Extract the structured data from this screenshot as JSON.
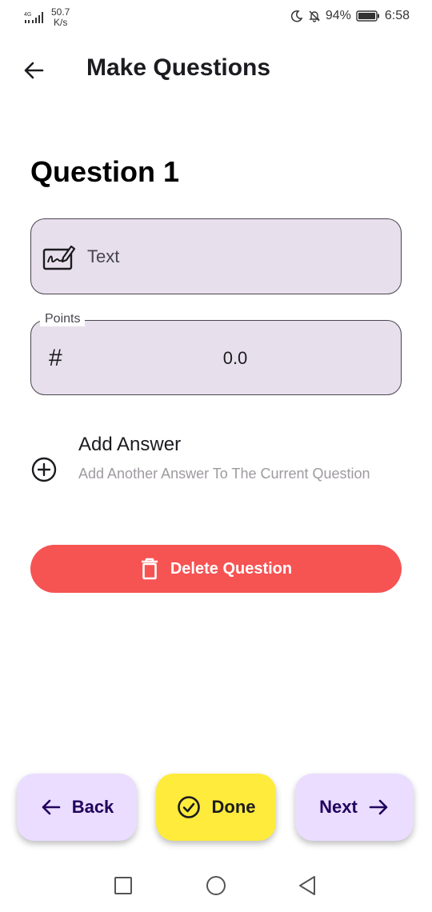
{
  "status_bar": {
    "network_type": "4G",
    "net_speed_value": "50.7",
    "net_speed_unit": "K/s",
    "battery_percent": "94%",
    "time": "6:58"
  },
  "app_bar": {
    "title": "Make Questions"
  },
  "question": {
    "title": "Question 1",
    "text_placeholder": "Text",
    "points_label": "Points",
    "points_value": "0.0"
  },
  "add_answer": {
    "title": "Add Answer",
    "subtitle": "Add Another Answer To The Current Question"
  },
  "actions": {
    "delete_label": "Delete Question",
    "back_label": "Back",
    "done_label": "Done",
    "next_label": "Next"
  },
  "icons": {
    "back": "arrow-left-icon",
    "signature": "signature-icon",
    "points": "hash-icon",
    "add": "add-circle-icon",
    "delete": "trash-icon",
    "done": "check-circle-icon",
    "next": "arrow-right-icon"
  },
  "colors": {
    "field_background": "#e7e0ec",
    "delete_button": "#f65353",
    "nav_button": "#eaddff",
    "done_button": "#ffeb3b"
  }
}
